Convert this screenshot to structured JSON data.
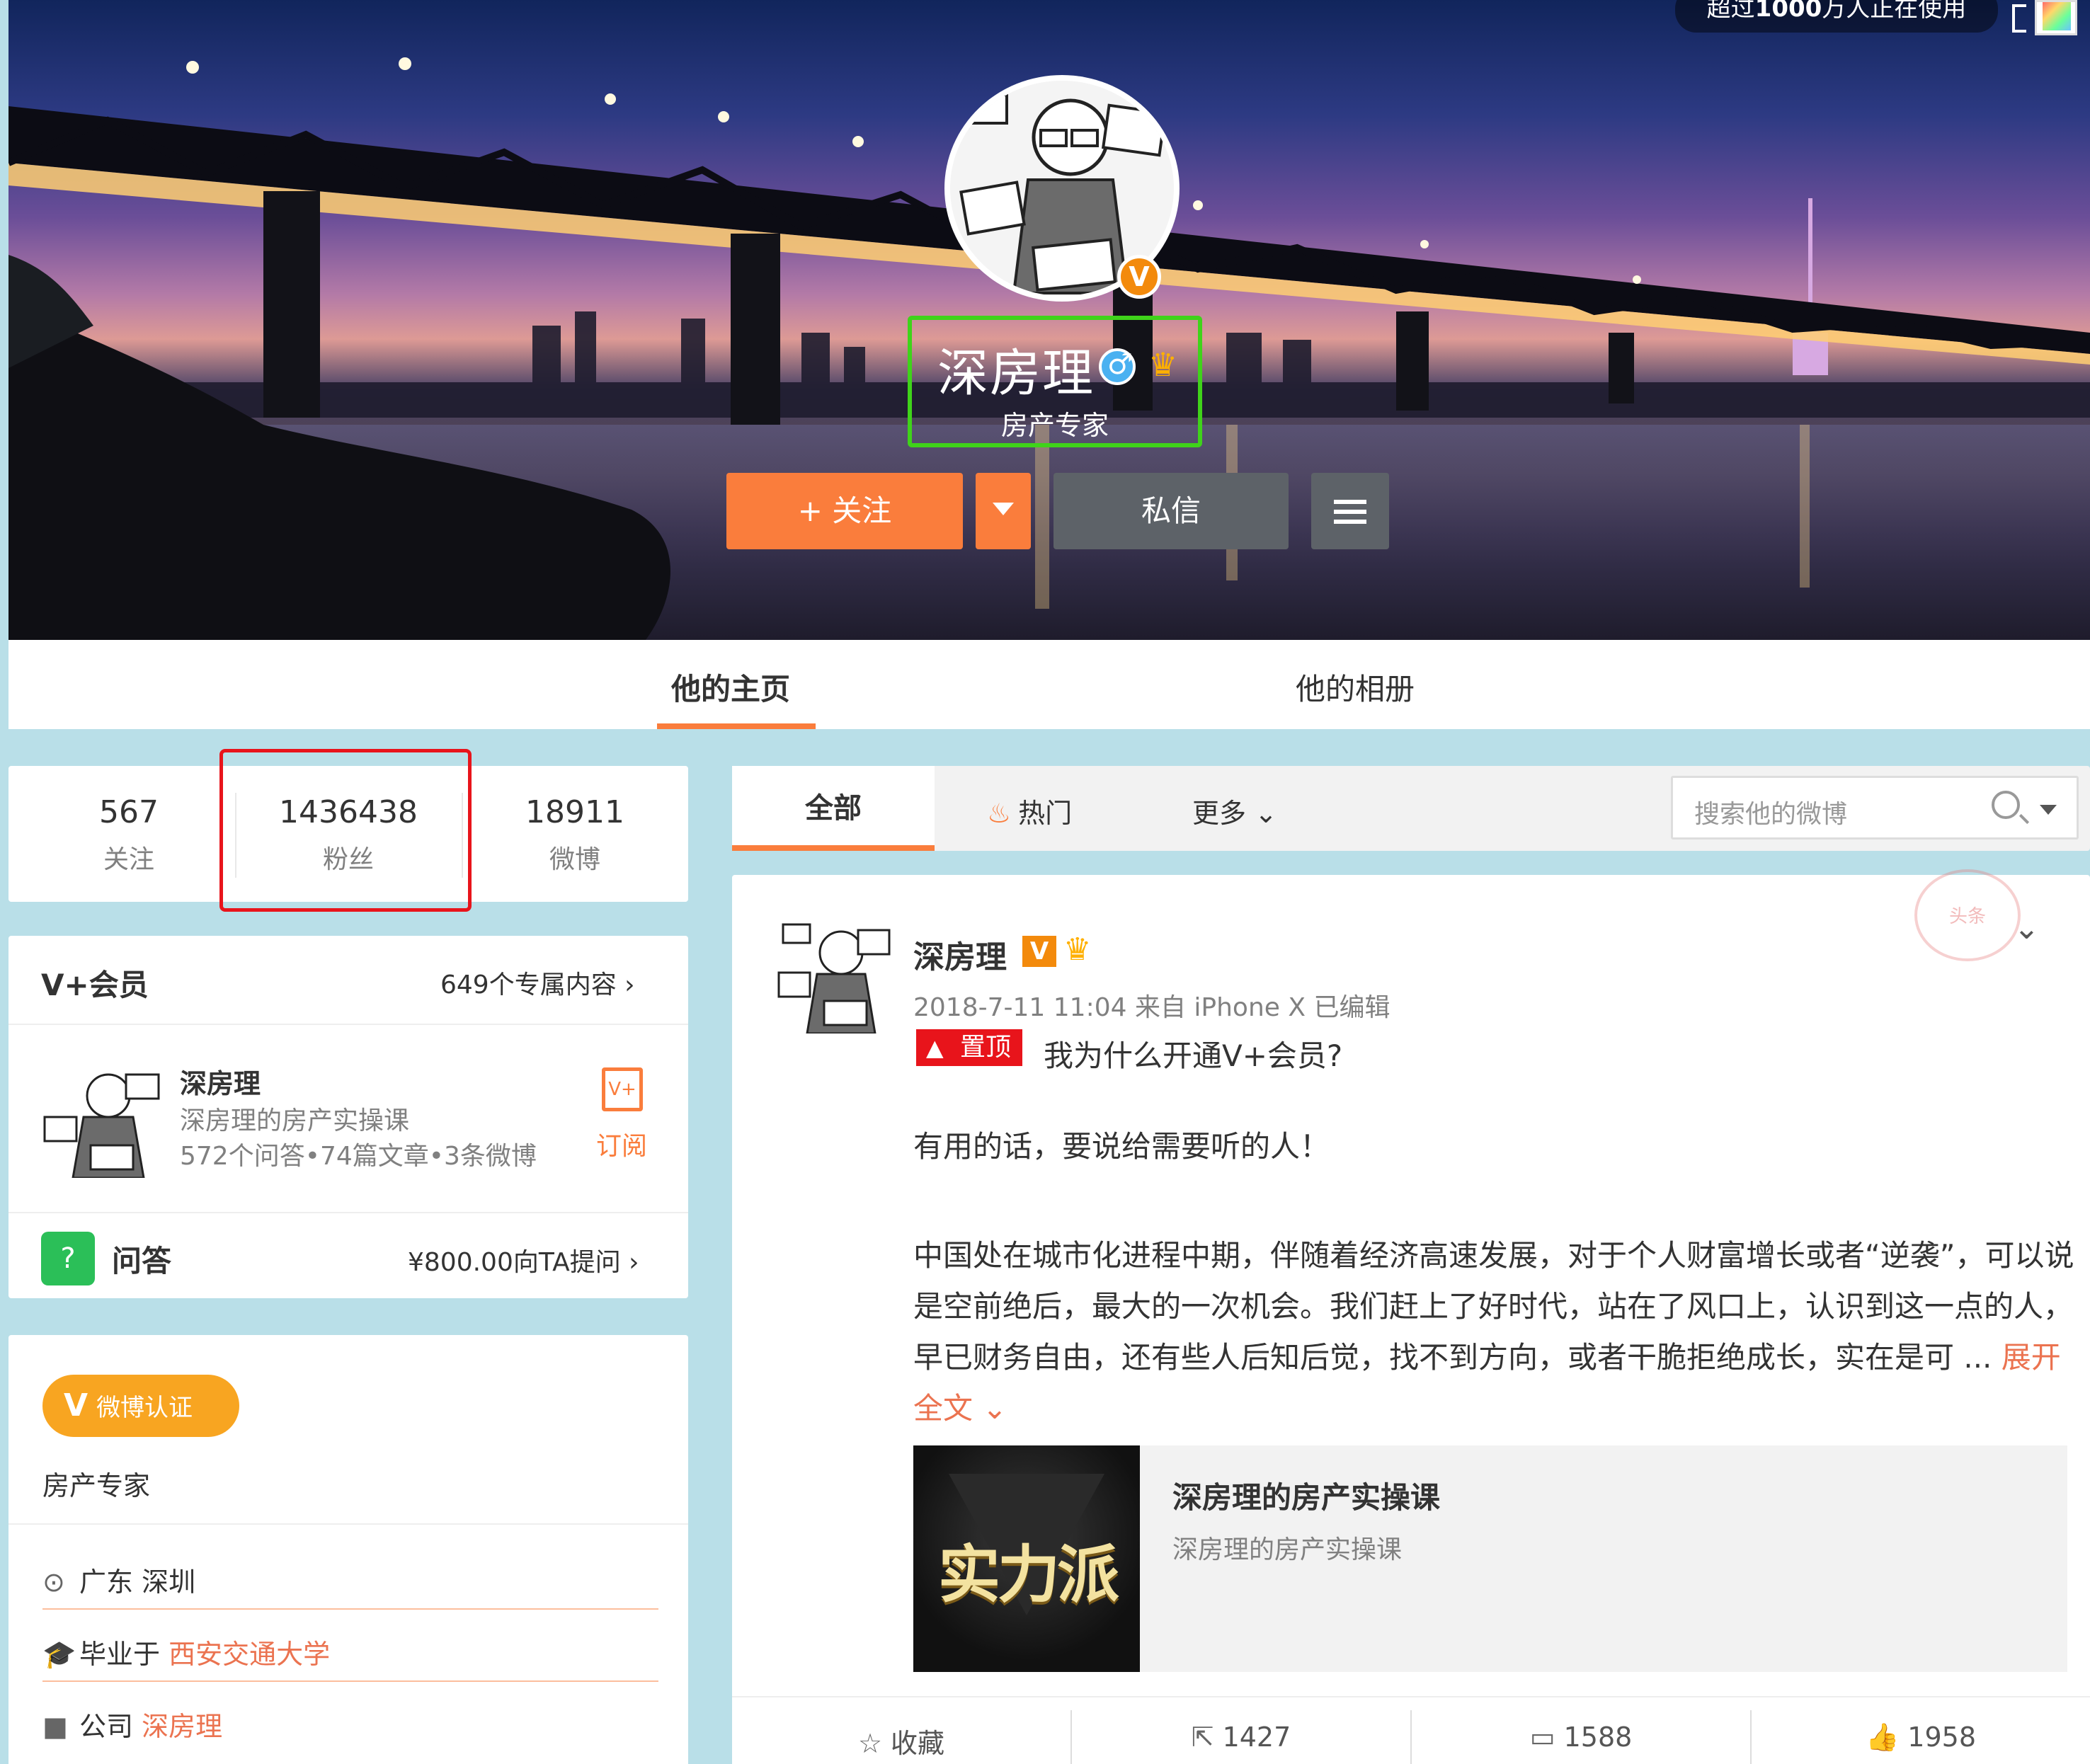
{
  "cover": {
    "watch_text_bold": "1000",
    "watch_text_prefix": "超过",
    "watch_text_suffix": "万人正在使用"
  },
  "profile": {
    "name": "深房理",
    "subtitle": "房产专家",
    "v_badge": "V",
    "follow_label": "+ 关注",
    "message_label": "私信"
  },
  "tabs": {
    "home": "他的主页",
    "album": "他的相册"
  },
  "stats": [
    {
      "num": "567",
      "label": "关注"
    },
    {
      "num": "1436438",
      "label": "粉丝"
    },
    {
      "num": "18911",
      "label": "微博"
    }
  ],
  "vip": {
    "title": "V+会员",
    "exclusive": "649个专属内容 ›",
    "author": "深房理",
    "course": "深房理的房产实操课",
    "meta": "572个问答•74篇文章•3条微博",
    "subscribe_icon": "V+",
    "subscribe": "订阅"
  },
  "qa": {
    "icon": "?",
    "title": "问答",
    "price": "¥800.00向TA提问 ›"
  },
  "info": {
    "badge_v": "V",
    "badge_label": "微博认证",
    "verified_text": "房产专家",
    "location_icon": "⊙",
    "location": "广东 深圳",
    "edu_icon": "🎓",
    "edu_prefix": "毕业于 ",
    "edu_school": "西安交通大学",
    "company_icon": "■",
    "company_prefix": "公司 ",
    "company_name": "深房理"
  },
  "filter": {
    "all": "全部",
    "hot_icon": "♨",
    "hot": "热门",
    "more": "更多 ⌄",
    "search_placeholder": "搜索他的微博"
  },
  "post": {
    "stamp": "头条",
    "author": "深房理",
    "v": "V",
    "crown": "♛",
    "time": "2018-7-11 11:04 来自 iPhone X  已编辑",
    "pin": "置顶",
    "title": "我为什么开通V+会员?",
    "line1": "有用的话，要说给需要听的人！",
    "para": "中国处在城市化进程中期，伴随着经济高速发展，对于个人财富增长或者“逆袭”，可以说是空前绝后，最大的一次机会。我们赶上了好时代，站在了风口上，认识到这一点的人，早已财务自由，还有些人后知后觉，找不到方向，或者干脆拒绝成长，实在是可 ... ",
    "expand": "展开全文 ⌄",
    "card_image_text": "实力派",
    "card_title": "深房理的房产实操课",
    "card_sub": "深房理的房产实操课"
  },
  "actions": [
    {
      "icon": "☆",
      "label": "收藏"
    },
    {
      "icon": "⇱",
      "label": "1427"
    },
    {
      "icon": "▭",
      "label": "1588"
    },
    {
      "icon": "👍",
      "label": "1958"
    }
  ],
  "colors": {
    "accent": "#fa7d3c",
    "highlight_green": "#3fd31a",
    "highlight_red": "#e8141b",
    "background": "#b9dfe8"
  }
}
